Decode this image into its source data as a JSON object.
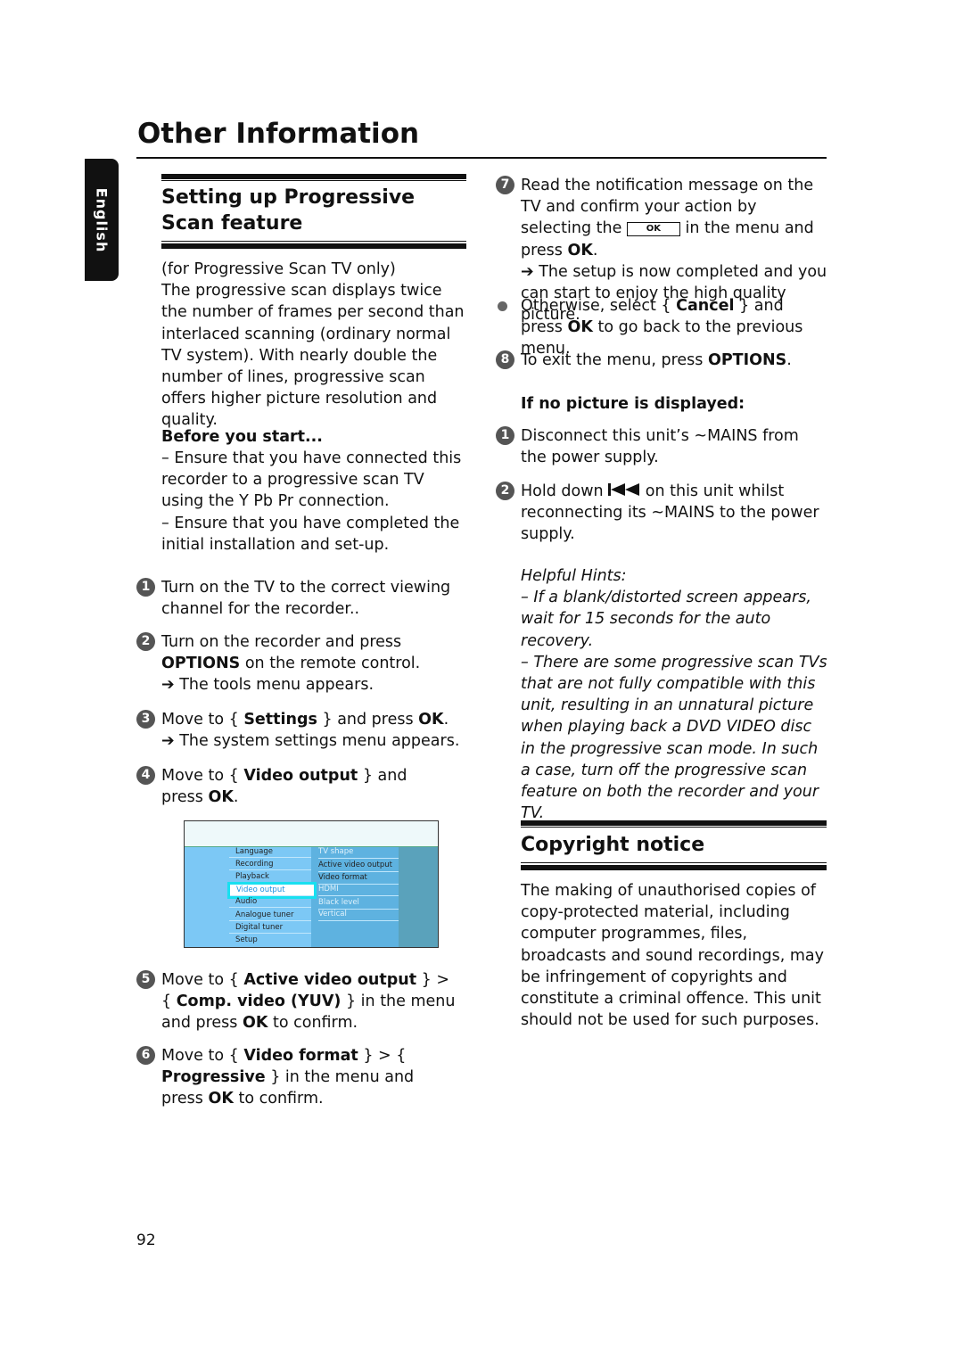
{
  "page_title": "Other Information",
  "language_tab": "English",
  "page_number": "92",
  "left": {
    "section_title": "Setting up Progressive Scan feature",
    "intro": [
      {
        "t": "(for Progressive Scan TV only)"
      },
      {
        "br": 1
      },
      {
        "t": "The progressive scan displays twice the number of frames per second than interlaced scanning (ordinary normal TV system). With nearly double the number of lines, progressive scan offers higher picture resolution and quality."
      }
    ],
    "before_heading": "Before you start...",
    "before": [
      {
        "t": "– Ensure that you have connected this recorder to a progressive scan TV using the Y Pb Pr connection."
      },
      {
        "br": 1
      },
      {
        "t": "– Ensure that you have completed the initial installation and set-up."
      }
    ],
    "steps": [
      {
        "n": "1",
        "text": [
          {
            "t": "Turn on the TV to the correct viewing channel for the recorder.."
          }
        ]
      },
      {
        "n": "2",
        "text": [
          {
            "t": "Turn on the recorder and press "
          },
          {
            "t": "OPTIONS",
            "b": 1
          },
          {
            "t": " on the remote control."
          },
          {
            "br": 1
          },
          {
            "t": "➔ The tools menu appears."
          }
        ]
      },
      {
        "n": "3",
        "text": [
          {
            "t": "Move to { "
          },
          {
            "t": "Settings",
            "b": 1
          },
          {
            "t": " } and press "
          },
          {
            "t": "OK",
            "b": 1
          },
          {
            "t": "."
          },
          {
            "br": 1
          },
          {
            "t": "➔ The system settings menu appears."
          }
        ]
      },
      {
        "n": "4",
        "text": [
          {
            "t": "Move to { "
          },
          {
            "t": "Video output",
            "b": 1
          },
          {
            "t": " } and press "
          },
          {
            "t": "OK",
            "b": 1
          },
          {
            "t": "."
          }
        ]
      },
      {
        "n": "5",
        "text": [
          {
            "t": "Move to { "
          },
          {
            "t": "Active video output",
            "b": 1
          },
          {
            "t": " } > { "
          },
          {
            "t": "Comp. video (YUV)",
            "b": 1
          },
          {
            "t": " } in the menu and press "
          },
          {
            "t": "OK",
            "b": 1
          },
          {
            "t": " to confirm."
          }
        ]
      },
      {
        "n": "6",
        "text": [
          {
            "t": "Move to { "
          },
          {
            "t": "Video format",
            "b": 1
          },
          {
            "t": " } > { "
          },
          {
            "t": "Progressive",
            "b": 1
          },
          {
            "t": " } in the menu and press "
          },
          {
            "t": "OK",
            "b": 1
          },
          {
            "t": " to confirm."
          }
        ]
      }
    ],
    "menu": {
      "left_items": [
        "Language",
        "Recording",
        "Playback",
        "Video output",
        "Audio",
        "Analogue tuner",
        "Digital tuner",
        "Setup"
      ],
      "selected": "Video output",
      "right_items": [
        "TV shape",
        "Active video output",
        "Video format",
        "HDMI",
        "Black level",
        "Vertical"
      ]
    }
  },
  "right": {
    "step7": {
      "n": "7",
      "before": "Read the notification message on the TV and confirm your action by selecting the ",
      "ok_label": "OK",
      "after": " in the menu and press ",
      "after_bold": "OK",
      "end": ".",
      "result": "➔ The setup is now completed and you can start to enjoy the high quality picture."
    },
    "bullet": [
      {
        "t": "Otherwise, select { "
      },
      {
        "t": "Cancel",
        "b": 1
      },
      {
        "t": " } and press "
      },
      {
        "t": "OK",
        "b": 1
      },
      {
        "t": " to go back to the previous menu."
      }
    ],
    "step8": {
      "n": "8",
      "text": [
        {
          "t": "To exit the menu, press "
        },
        {
          "t": "OPTIONS",
          "b": 1
        },
        {
          "t": "."
        }
      ]
    },
    "no_picture_heading": "If no picture is displayed:",
    "np_steps": [
      {
        "n": "1",
        "text": [
          {
            "t": "Disconnect this unit’s ~MAINS from the power supply."
          }
        ]
      },
      {
        "n": "2",
        "before": "Hold down ",
        "after": " on this unit whilst reconnecting its ~MAINS to the power supply.",
        "icon": "previous-track-icon"
      }
    ],
    "hints_title": "Helpful Hints:",
    "hints": [
      "– If a blank/distorted screen appears, wait for 15 seconds for the auto recovery.",
      "– There are some progressive scan TVs that are not fully compatible with this unit, resulting in an unnatural picture when playing back a DVD VIDEO disc in the progressive scan mode. In such a case, turn off the progressive scan feature on both the recorder and your TV."
    ],
    "copyright_title": "Copyright notice",
    "copyright_text": "The making of unauthorised copies of copy-protected material, including computer programmes, files, broadcasts and sound recordings, may be infringement of copyrights and constitute a criminal offence.  This unit should not be used for such purposes."
  }
}
